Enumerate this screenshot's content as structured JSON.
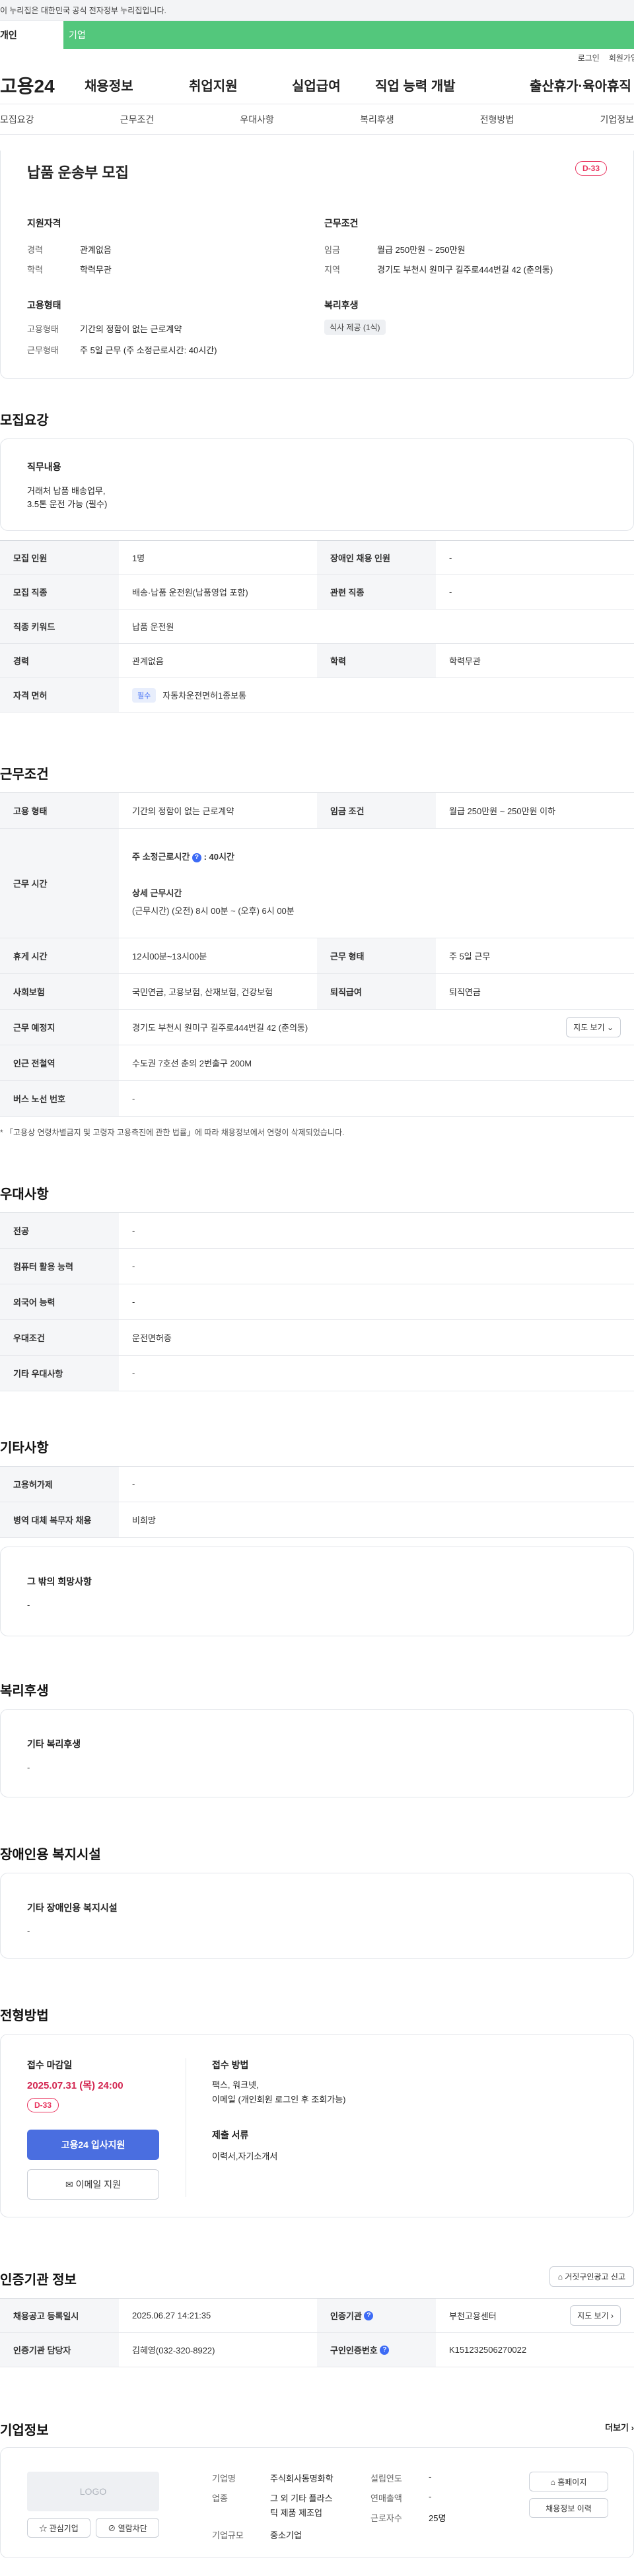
{
  "gov_banner": "이 누리집은 대한민국 공식 전자정부 누리집입니다.",
  "tabs": {
    "individual": "개인",
    "company": "기업"
  },
  "utility": {
    "login": "로그인",
    "signup": "회원가입"
  },
  "logo": "고용24",
  "gnb": [
    "채용정보",
    "취업지원",
    "실업급여",
    "직업 능력 개발",
    "출산휴가·육아휴직"
  ],
  "subnav": [
    "모집요강",
    "근무조건",
    "우대사항",
    "복리후생",
    "전형방법",
    "기업정보"
  ],
  "summary": {
    "title": "납품 운송부 모집",
    "dday": "D-33",
    "qualification_heading": "지원자격",
    "career_label": "경력",
    "career_value": "관계없음",
    "education_label": "학력",
    "education_value": "학력무관",
    "employment_heading": "고용형태",
    "employment_type_label": "고용형태",
    "employment_type_value": "기간의 정함이 없는 근로계약",
    "work_type_label": "근무형태",
    "work_type_value": "주 5일 근무 (주 소정근로시간: 40시간)",
    "conditions_heading": "근무조건",
    "wage_label": "임금",
    "wage_value": "월급 250만원 ~ 250만원",
    "region_label": "지역",
    "region_value": "경기도 부천시 원미구 길주로444번길 42 (춘의동)",
    "welfare_heading": "복리후생",
    "welfare_chip": "식사 제공 (1식)"
  },
  "recruit": {
    "section_title": "모집요강",
    "duty_heading": "직무내용",
    "duty_text_1": "거래처 납품 배송업무,",
    "duty_text_2": "3.5톤 운전 가능 (필수)",
    "rows": {
      "headcount_label": "모집 인원",
      "headcount_value": "1명",
      "disabled_label": "장애인 채용 인원",
      "disabled_value": "-",
      "job_label": "모집 직종",
      "job_value": "배송·납품 운전원(납품영업 포함)",
      "related_label": "관련 직종",
      "related_value": "-",
      "keyword_label": "직종 키워드",
      "keyword_value": "납품 운전원",
      "career_label": "경력",
      "career_value": "관계없음",
      "edu_label": "학력",
      "edu_value": "학력무관",
      "license_label": "자격 면허",
      "license_badge": "필수",
      "license_value": "자동차운전면허1종보통"
    }
  },
  "conditions": {
    "section_title": "근무조건",
    "employment_label": "고용 형태",
    "employment_value": "기간의 정함이 없는 근로계약",
    "wage_label": "임금 조건",
    "wage_value": "월급 250만원 ~ 250만원 이하",
    "hours_label": "근무 시간",
    "hours_heading": "주 소정근로시간",
    "hours_value": ": 40시간",
    "hours_detail_heading": "상세 근무시간",
    "hours_detail": "(근무시간) (오전) 8시 00분 ~ (오후) 6시 00분",
    "break_label": "휴게 시간",
    "break_value": "12시00분~13시00분",
    "worktype_label": "근무 형태",
    "worktype_value": "주 5일 근무",
    "insurance_label": "사회보험",
    "insurance_value": "국민연금, 고용보험, 산재보험, 건강보험",
    "retire_label": "퇴직급여",
    "retire_value": "퇴직연금",
    "location_label": "근무 예정지",
    "location_value": "경기도 부천시 원미구 길주로444번길 42 (춘의동)",
    "map_button": "지도 보기",
    "subway_label": "인근 전철역",
    "subway_value": "수도권 7호선 춘의 2번출구 200M",
    "bus_label": "버스 노선 번호",
    "bus_value": "-",
    "notice": "「고용상 연령차별금지 및 고령자 고용촉진에 관한 법률」에 따라 채용정보에서 연령이 삭제되었습니다."
  },
  "preference": {
    "section_title": "우대사항",
    "major_label": "전공",
    "major_value": "-",
    "computer_label": "컴퓨터 활용 능력",
    "computer_value": "-",
    "language_label": "외국어 능력",
    "language_value": "-",
    "pref_label": "우대조건",
    "pref_value": "운전면허증",
    "other_label": "기타 우대사항",
    "other_value": "-"
  },
  "etc": {
    "section_title": "기타사항",
    "permit_label": "고용허가제",
    "permit_value": "-",
    "military_label": "병역 대체 복무자 채용",
    "military_value": "비희망",
    "wish_heading": "그 밖의 희망사항",
    "wish_value": "-"
  },
  "welfare": {
    "section_title": "복리후생",
    "other_heading": "기타 복리후생",
    "other_value": "-"
  },
  "disabled_facility": {
    "section_title": "장애인용 복지시설",
    "heading": "기타 장애인용 복지시설",
    "value": "-"
  },
  "selection": {
    "section_title": "전형방법",
    "deadline_heading": "접수 마감일",
    "deadline_value": "2025.07.31 (목) 24:00",
    "dday": "D-33",
    "apply_button": "고용24 입사지원",
    "email_button": "이메일 지원",
    "method_heading": "접수 방법",
    "method_line1": "팩스, 워크넷,",
    "method_line2": "이메일 (개인회원 로그인 후 조회가능)",
    "docs_heading": "제출 서류",
    "docs_value": "이력서,자기소개서"
  },
  "certified": {
    "section_title": "인증기관 정보",
    "report_button": "거짓구인광고 신고",
    "reg_date_label": "채용공고 등록일시",
    "reg_date_value": "2025.06.27 14:21:35",
    "org_label": "인증기관",
    "org_value": "부천고용센터",
    "map_button": "지도 보기",
    "manager_label": "인증기관 담당자",
    "manager_value": "김혜영(032-320-8922)",
    "cert_no_label": "구인인증번호",
    "cert_no_value": "K151232506270022"
  },
  "company": {
    "section_title": "기업정보",
    "more": "더보기",
    "logo_text": "LOGO",
    "interest_button": "관심기업",
    "block_button": "열람차단",
    "name_label": "기업명",
    "name_value": "주식회사동명화학",
    "industry_label": "업종",
    "industry_value_1": "그 외 기타 플라스",
    "industry_value_2": "틱 제품 제조업",
    "scale_label": "기업규모",
    "scale_value": "중소기업",
    "founded_label": "설립연도",
    "founded_value": "-",
    "revenue_label": "연매출액",
    "revenue_value": "-",
    "employees_label": "근로자수",
    "employees_value": "25명",
    "homepage_button": "홈페이지",
    "jobs_button": "채용정보 이력"
  }
}
